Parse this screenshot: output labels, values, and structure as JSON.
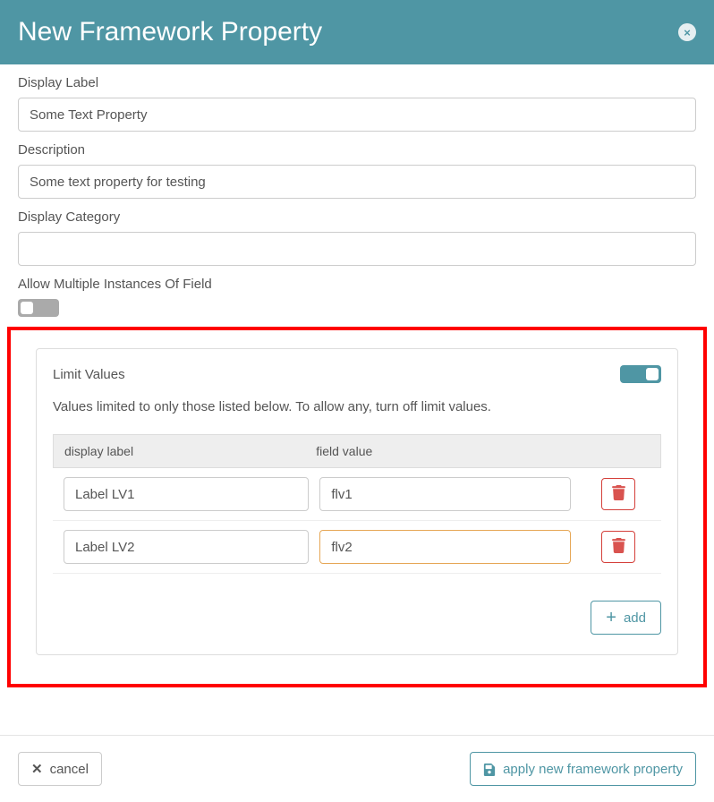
{
  "header": {
    "title": "New Framework Property",
    "close_glyph": "×"
  },
  "form": {
    "display_label": {
      "label": "Display Label",
      "value": "Some Text Property"
    },
    "description": {
      "label": "Description",
      "value": "Some text property for testing"
    },
    "display_category": {
      "label": "Display Category",
      "value": ""
    },
    "allow_multiple": {
      "label": "Allow Multiple Instances Of Field",
      "on": false
    }
  },
  "limit": {
    "title": "Limit Values",
    "on": true,
    "help": "Values limited to only those listed below. To allow any, turn off limit values.",
    "columns": {
      "label": "display label",
      "value": "field value"
    },
    "rows": [
      {
        "label": "Label LV1",
        "value": "flv1"
      },
      {
        "label": "Label LV2",
        "value": "flv2"
      }
    ],
    "add_label": "add"
  },
  "footer": {
    "cancel": "cancel",
    "apply": "apply new framework property"
  }
}
